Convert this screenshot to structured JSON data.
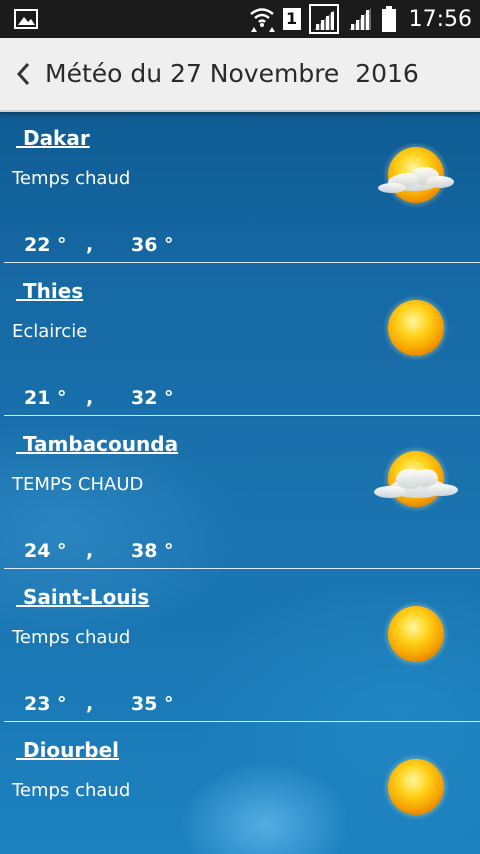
{
  "status_bar": {
    "sim_slot": "1",
    "time": "17:56",
    "icons": [
      "picture-icon",
      "wifi-icon",
      "sim-icon",
      "signal-icon",
      "signal-icon",
      "battery-icon"
    ]
  },
  "action_bar": {
    "title": "Météo du 27 Novembre  2016",
    "back_icon": "chevron-left-icon"
  },
  "forecasts": [
    {
      "city": " Dakar",
      "description": "Temps chaud",
      "tmin": "22 °",
      "separator": ",",
      "tmax": "36 °",
      "icon": "sun-cloud-icon"
    },
    {
      "city": " Thies",
      "description": "Eclaircie",
      "tmin": "21 °",
      "separator": ",",
      "tmax": "32 °",
      "icon": "sun-icon"
    },
    {
      "city": " Tambacounda",
      "description": "TEMPS CHAUD",
      "tmin": "24 °",
      "separator": ",",
      "tmax": "38 °",
      "icon": "sun-cloud-icon"
    },
    {
      "city": " Saint-Louis",
      "description": "Temps chaud",
      "tmin": "23 °",
      "separator": ",",
      "tmax": "35 °",
      "icon": "sun-icon"
    },
    {
      "city": " Diourbel",
      "description": "Temps chaud",
      "tmin": "",
      "separator": "",
      "tmax": "",
      "icon": "sun-icon"
    }
  ],
  "colors": {
    "status_bar": "#1b1b1b",
    "action_bar": "#efefef",
    "background": "#166aa6",
    "text": "#ffffff"
  }
}
